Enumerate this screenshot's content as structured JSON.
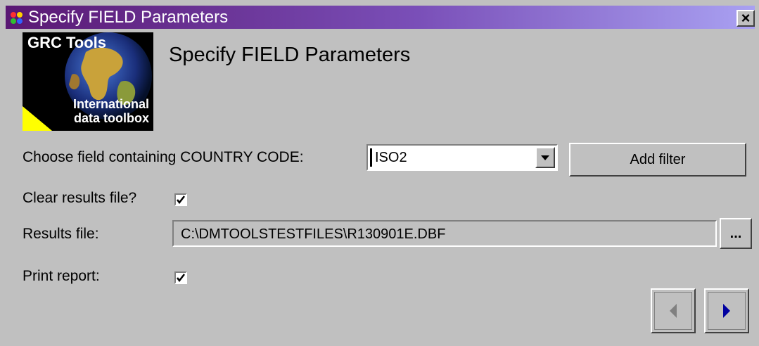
{
  "window": {
    "title": "Specify FIELD Parameters",
    "close_label": "×"
  },
  "logo": {
    "line1": "GRC Tools",
    "line2": "International",
    "line3": "data toolbox"
  },
  "heading": "Specify FIELD Parameters",
  "country_code": {
    "label": "Choose field containing COUNTRY CODE:",
    "value": "ISO2"
  },
  "add_filter_label": "Add filter",
  "clear_results": {
    "label": "Clear results file?",
    "checked": true
  },
  "results_file": {
    "label": "Results file:",
    "value": "C:\\DMTOOLSTESTFILES\\R130901E.DBF",
    "browse_label": "..."
  },
  "print_report": {
    "label": "Print report:",
    "checked": true
  },
  "icons": {
    "back": "chevron-left-icon",
    "next": "chevron-right-icon",
    "dropdown": "chevron-down-icon",
    "app": "app-icon",
    "checkmark": "checkmark-icon"
  },
  "colors": {
    "titlebar_start": "#5a1873",
    "titlebar_end": "#a9a1f2",
    "dialog_bg": "#c0c0c0",
    "next_arrow": "#0000a0",
    "back_arrow_disabled": "#808080"
  }
}
